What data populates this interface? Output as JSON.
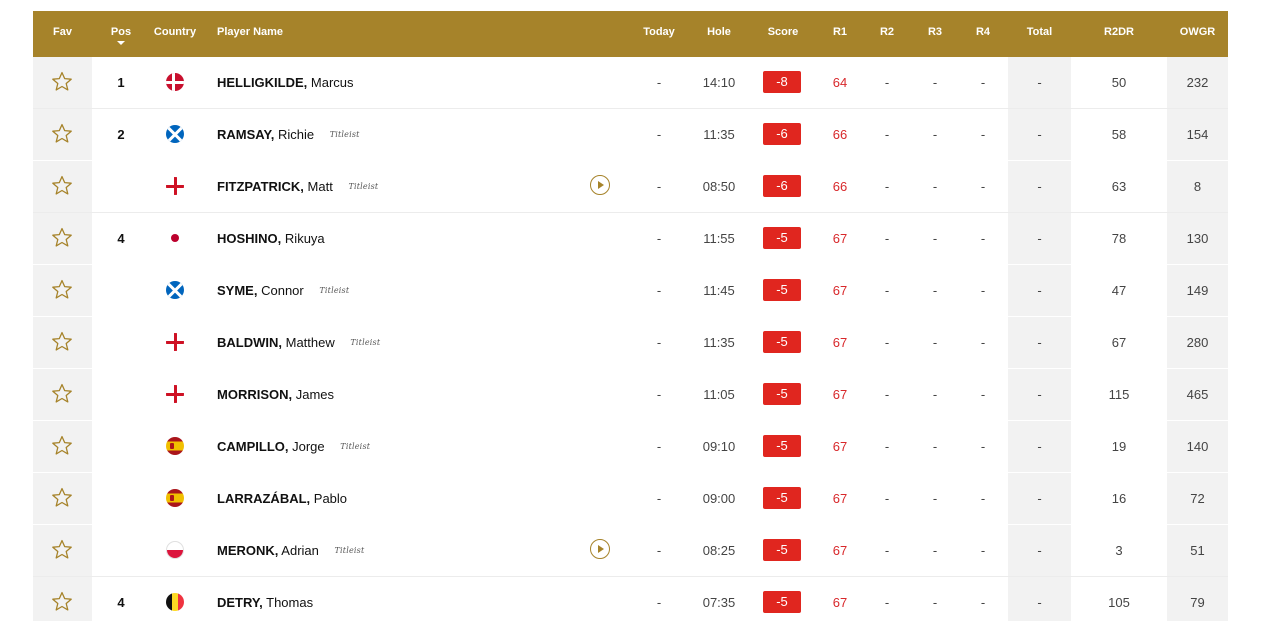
{
  "header": {
    "fav": "Fav",
    "pos": "Pos",
    "country": "Country",
    "player_name": "Player Name",
    "today": "Today",
    "hole": "Hole",
    "score": "Score",
    "r1": "R1",
    "r2": "R2",
    "r3": "R3",
    "r4": "R4",
    "total": "Total",
    "r2dr": "R2DR",
    "owgr": "OWGR"
  },
  "colors": {
    "header_bg": "#a6832a",
    "score_badge": "#e0261f",
    "r1_text": "#d8282b"
  },
  "players": [
    {
      "pos": "1",
      "country_flag": "denmark-flag-icon",
      "surname": "HELLIGKILDE,",
      "first_name": "Marcus",
      "sponsor": "",
      "video": false,
      "today": "-",
      "hole": "14:10",
      "score": "-8",
      "r1": "64",
      "r2": "-",
      "r3": "-",
      "r4": "-",
      "total": "-",
      "r2dr": "50",
      "owgr": "232"
    },
    {
      "pos": "2",
      "country_flag": "scotland-flag-icon",
      "surname": "RAMSAY,",
      "first_name": "Richie",
      "sponsor": "Titleist",
      "video": false,
      "today": "-",
      "hole": "11:35",
      "score": "-6",
      "r1": "66",
      "r2": "-",
      "r3": "-",
      "r4": "-",
      "total": "-",
      "r2dr": "58",
      "owgr": "154"
    },
    {
      "pos": "",
      "country_flag": "england-flag-icon",
      "surname": "FITZPATRICK,",
      "first_name": "Matt",
      "sponsor": "Titleist",
      "video": true,
      "today": "-",
      "hole": "08:50",
      "score": "-6",
      "r1": "66",
      "r2": "-",
      "r3": "-",
      "r4": "-",
      "total": "-",
      "r2dr": "63",
      "owgr": "8"
    },
    {
      "pos": "4",
      "country_flag": "japan-flag-icon",
      "surname": "HOSHINO,",
      "first_name": "Rikuya",
      "sponsor": "",
      "video": false,
      "today": "-",
      "hole": "11:55",
      "score": "-5",
      "r1": "67",
      "r2": "-",
      "r3": "-",
      "r4": "-",
      "total": "-",
      "r2dr": "78",
      "owgr": "130"
    },
    {
      "pos": "",
      "country_flag": "scotland-flag-icon",
      "surname": "SYME,",
      "first_name": "Connor",
      "sponsor": "Titleist",
      "video": false,
      "today": "-",
      "hole": "11:45",
      "score": "-5",
      "r1": "67",
      "r2": "-",
      "r3": "-",
      "r4": "-",
      "total": "-",
      "r2dr": "47",
      "owgr": "149"
    },
    {
      "pos": "",
      "country_flag": "england-flag-icon",
      "surname": "BALDWIN,",
      "first_name": "Matthew",
      "sponsor": "Titleist",
      "video": false,
      "today": "-",
      "hole": "11:35",
      "score": "-5",
      "r1": "67",
      "r2": "-",
      "r3": "-",
      "r4": "-",
      "total": "-",
      "r2dr": "67",
      "owgr": "280"
    },
    {
      "pos": "",
      "country_flag": "england-flag-icon",
      "surname": "MORRISON,",
      "first_name": "James",
      "sponsor": "",
      "video": false,
      "today": "-",
      "hole": "11:05",
      "score": "-5",
      "r1": "67",
      "r2": "-",
      "r3": "-",
      "r4": "-",
      "total": "-",
      "r2dr": "115",
      "owgr": "465"
    },
    {
      "pos": "",
      "country_flag": "spain-flag-icon",
      "surname": "CAMPILLO,",
      "first_name": "Jorge",
      "sponsor": "Titleist",
      "video": false,
      "today": "-",
      "hole": "09:10",
      "score": "-5",
      "r1": "67",
      "r2": "-",
      "r3": "-",
      "r4": "-",
      "total": "-",
      "r2dr": "19",
      "owgr": "140"
    },
    {
      "pos": "",
      "country_flag": "spain-flag-icon",
      "surname": "LARRAZÁBAL,",
      "first_name": "Pablo",
      "sponsor": "",
      "video": false,
      "today": "-",
      "hole": "09:00",
      "score": "-5",
      "r1": "67",
      "r2": "-",
      "r3": "-",
      "r4": "-",
      "total": "-",
      "r2dr": "16",
      "owgr": "72"
    },
    {
      "pos": "",
      "country_flag": "poland-flag-icon",
      "surname": "MERONK,",
      "first_name": "Adrian",
      "sponsor": "Titleist",
      "video": true,
      "today": "-",
      "hole": "08:25",
      "score": "-5",
      "r1": "67",
      "r2": "-",
      "r3": "-",
      "r4": "-",
      "total": "-",
      "r2dr": "3",
      "owgr": "51"
    },
    {
      "pos": "4",
      "country_flag": "belgium-flag-icon",
      "surname": "DETRY,",
      "first_name": "Thomas",
      "sponsor": "",
      "video": false,
      "today": "-",
      "hole": "07:35",
      "score": "-5",
      "r1": "67",
      "r2": "-",
      "r3": "-",
      "r4": "-",
      "total": "-",
      "r2dr": "105",
      "owgr": "79"
    }
  ]
}
